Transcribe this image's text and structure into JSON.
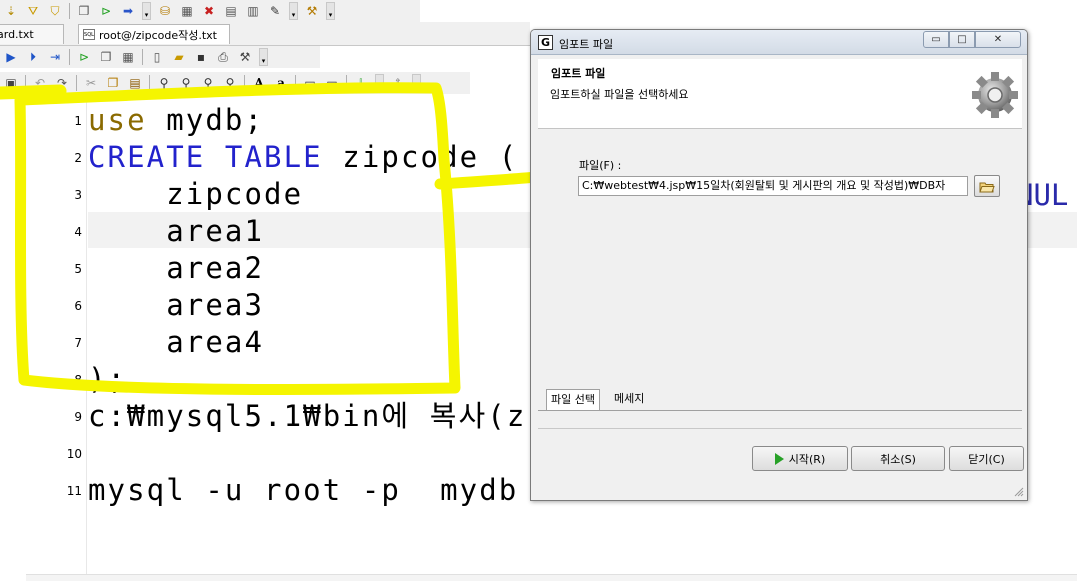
{
  "editor": {
    "tabs": [
      "ard.txt",
      "root@/zipcode작성.txt"
    ],
    "lines": [
      {
        "num": "1",
        "parts": [
          {
            "t": "use",
            "c": "kw2"
          },
          {
            "t": " mydb;",
            "c": ""
          }
        ]
      },
      {
        "num": "2",
        "parts": [
          {
            "t": "CREATE TABLE",
            "c": "kw"
          },
          {
            "t": " zipcode (",
            "c": ""
          }
        ]
      },
      {
        "num": "3",
        "parts": [
          {
            "t": "    zipcode",
            "c": ""
          }
        ]
      },
      {
        "num": "4",
        "parts": [
          {
            "t": "    area1",
            "c": ""
          }
        ]
      },
      {
        "num": "5",
        "parts": [
          {
            "t": "    area2",
            "c": ""
          }
        ]
      },
      {
        "num": "6",
        "parts": [
          {
            "t": "    area3",
            "c": ""
          }
        ]
      },
      {
        "num": "7",
        "parts": [
          {
            "t": "    area4",
            "c": ""
          }
        ]
      },
      {
        "num": "8",
        "parts": [
          {
            "t": ");",
            "c": ""
          }
        ]
      },
      {
        "num": "9",
        "parts": [
          {
            "t": "c:₩mysql5.1₩bin에 복사(z",
            "c": ""
          }
        ]
      },
      {
        "num": "10",
        "parts": []
      },
      {
        "num": "11",
        "parts": [
          {
            "t": "mysql -u root -p  mydb <",
            "c": ""
          }
        ]
      }
    ],
    "overflow_text": "NUL"
  },
  "dialog": {
    "window_title": "임포트 파일",
    "header_title": "임포트 파일",
    "header_subtitle": "임포트하실 파일을 선택하세요",
    "file_label": "파일(F) :",
    "file_path": "C:₩webtest₩4.jsp₩15일차(회원탈퇴 및 게시판의 개요 및 작성법)₩DB자",
    "tabs": [
      "파일 선택",
      "메세지"
    ],
    "buttons": {
      "start": "시작(R)",
      "cancel": "취소(S)",
      "close": "닫기(C)"
    },
    "window_buttons": {
      "minimize": "▭",
      "maximize": "□",
      "close": "✕"
    }
  },
  "toolbar_icons": {
    "row1": [
      "arrow-icon",
      "funnel-icon",
      "funnel-check-icon",
      "copy-icon",
      "step-icon",
      "run-icon",
      "dropdown",
      "db-icon",
      "grid-icon",
      "delete-icon",
      "doc-icon",
      "doc2-icon",
      "script-icon",
      "tools-icon"
    ],
    "row3_text": [
      "A",
      "a"
    ]
  },
  "colors": {
    "keyword_blue": "#2222cc",
    "keyword_olive": "#8a6a00",
    "highlighter": "#f5f500",
    "play_green": "#27a127"
  }
}
